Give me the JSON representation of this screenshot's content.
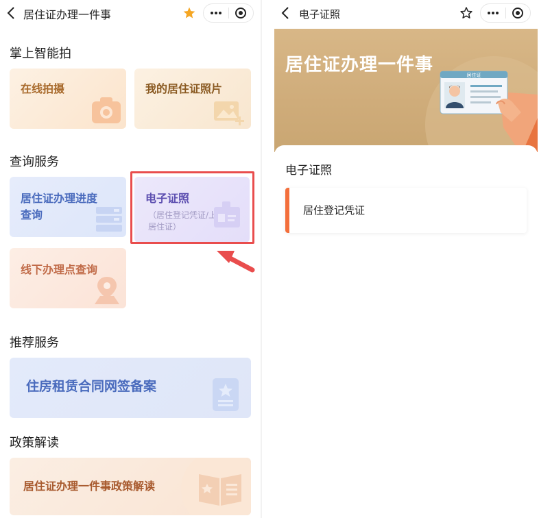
{
  "left": {
    "nav": {
      "title": "居住证办理一件事"
    },
    "sections": {
      "smart_photo": "掌上智能拍",
      "query": "查询服务",
      "recommend": "推荐服务",
      "policy": "政策解读"
    },
    "cards": {
      "online_photo": "在线拍摄",
      "my_photo": "我的居住证照片",
      "progress_line1": "居住证办理进度",
      "progress_line2": "查询",
      "ecert_title": "电子证照",
      "ecert_sub_line1": "（居住登记凭证/上海市",
      "ecert_sub_line2": "居住证）",
      "offline": "线下办理点查询",
      "rental": "住房租赁合同网签备案",
      "policy": "居住证办理一件事政策解读"
    }
  },
  "right": {
    "nav": {
      "title": "电子证照"
    },
    "banner": {
      "title": "居住证办理一件事",
      "card_label": "居住证"
    },
    "section": "电子证照",
    "items": [
      "居住登记凭证"
    ]
  },
  "colors": {
    "accent_star": "#f5a623",
    "highlight": "#e94d4d",
    "cert_bar": "#f36f3c",
    "banner": "#d4b27f"
  },
  "icons": [
    "chevron-left-icon",
    "star-filled-icon",
    "star-outline-icon",
    "more-icon",
    "target-icon",
    "camera-icon",
    "image-add-icon",
    "list-icon",
    "id-card-icon",
    "location-pin-icon",
    "star-badge-icon",
    "book-icon",
    "arrow-icon"
  ]
}
